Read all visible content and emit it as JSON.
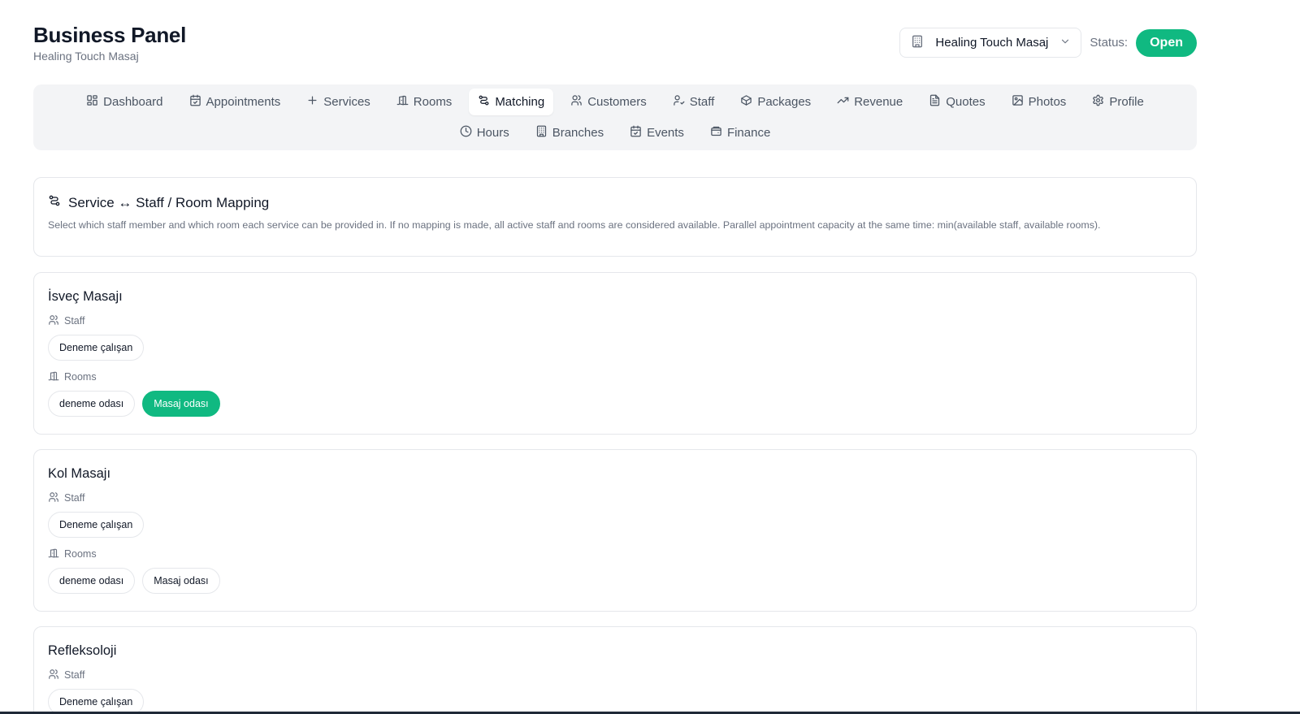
{
  "header": {
    "title": "Business Panel",
    "subtitle": "Healing Touch Masaj",
    "business_select": "Healing Touch Masaj",
    "status_label": "Status:",
    "status_value": "Open"
  },
  "colors": {
    "accent": "#10b981",
    "nav_bg": "#f3f4f6",
    "border": "#e5e7eb"
  },
  "nav": {
    "row1": [
      {
        "label": "Dashboard",
        "icon": "dashboard-icon"
      },
      {
        "label": "Appointments",
        "icon": "calendar-icon"
      },
      {
        "label": "Services",
        "icon": "plus-icon"
      },
      {
        "label": "Rooms",
        "icon": "door-icon"
      },
      {
        "label": "Matching",
        "icon": "route-icon",
        "active": true
      },
      {
        "label": "Customers",
        "icon": "users-icon"
      },
      {
        "label": "Staff",
        "icon": "user-check-icon"
      },
      {
        "label": "Packages",
        "icon": "package-icon"
      },
      {
        "label": "Revenue",
        "icon": "trending-up-icon"
      },
      {
        "label": "Quotes",
        "icon": "file-icon"
      },
      {
        "label": "Photos",
        "icon": "image-icon"
      },
      {
        "label": "Profile",
        "icon": "gear-icon"
      }
    ],
    "row2": [
      {
        "label": "Hours",
        "icon": "clock-icon"
      },
      {
        "label": "Branches",
        "icon": "building-icon"
      },
      {
        "label": "Events",
        "icon": "calendar-icon"
      },
      {
        "label": "Finance",
        "icon": "wallet-icon"
      }
    ]
  },
  "mapping": {
    "title": "Service ↔ Staff / Room Mapping",
    "description": "Select which staff member and which room each service can be provided in. If no mapping is made, all active staff and rooms are considered available. Parallel appointment capacity at the same time: min(available staff, available rooms)."
  },
  "labels": {
    "staff": "Staff",
    "rooms": "Rooms"
  },
  "services": [
    {
      "name": "İsveç Masajı",
      "staff": [
        {
          "label": "Deneme çalışan",
          "selected": false
        }
      ],
      "rooms": [
        {
          "label": "deneme odası",
          "selected": false
        },
        {
          "label": "Masaj odası",
          "selected": true
        }
      ]
    },
    {
      "name": "Kol Masajı",
      "staff": [
        {
          "label": "Deneme çalışan",
          "selected": false
        }
      ],
      "rooms": [
        {
          "label": "deneme odası",
          "selected": false
        },
        {
          "label": "Masaj odası",
          "selected": false
        }
      ]
    },
    {
      "name": "Refleksoloji",
      "staff": [
        {
          "label": "Deneme çalışan",
          "selected": false
        }
      ],
      "rooms": []
    }
  ]
}
